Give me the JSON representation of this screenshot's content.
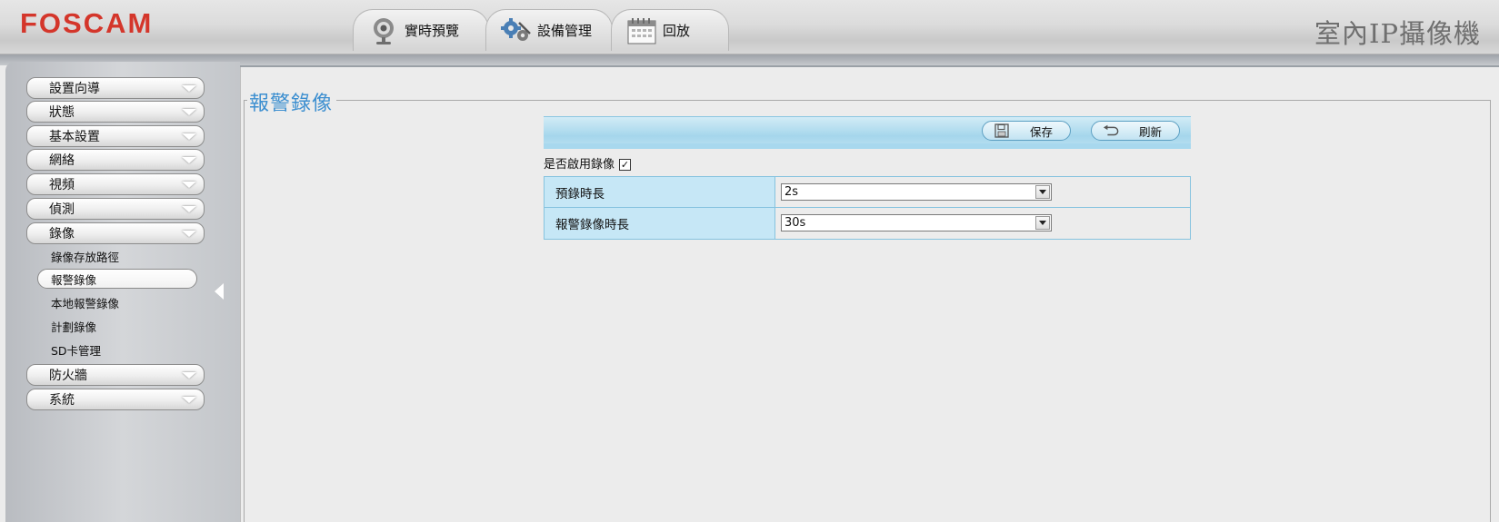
{
  "header": {
    "logo": "FOSCAM",
    "product_title": "室內IP攝像機",
    "tabs": [
      {
        "label": "實時預覽",
        "icon": "camera-icon"
      },
      {
        "label": "設備管理",
        "icon": "gears-icon"
      },
      {
        "label": "回放",
        "icon": "calendar-icon"
      }
    ]
  },
  "sidebar": {
    "menu_top": [
      {
        "label": "設置向導"
      },
      {
        "label": "狀態"
      },
      {
        "label": "基本設置"
      },
      {
        "label": "網絡"
      },
      {
        "label": "視頻"
      },
      {
        "label": "偵測"
      },
      {
        "label": "錄像"
      }
    ],
    "submenu": [
      {
        "label": "錄像存放路徑"
      },
      {
        "label": "報警錄像"
      },
      {
        "label": "本地報警錄像"
      },
      {
        "label": "計劃錄像"
      },
      {
        "label": "SD卡管理"
      }
    ],
    "menu_bottom": [
      {
        "label": "防火牆"
      },
      {
        "label": "系統"
      }
    ]
  },
  "main": {
    "title": "報警錄像",
    "toolbar": {
      "save_label": "保存",
      "refresh_label": "刷新"
    },
    "enable_label": "是否啟用錄像",
    "enable_checked": true,
    "fields": [
      {
        "label": "預錄時長",
        "value": "2s"
      },
      {
        "label": "報警錄像時長",
        "value": "30s"
      }
    ]
  },
  "colors": {
    "logo": "#d4362b",
    "title_blue": "#3d8fd0",
    "toolbar_blue": "#a5d6ec",
    "label_cell": "#c6e7f6"
  }
}
